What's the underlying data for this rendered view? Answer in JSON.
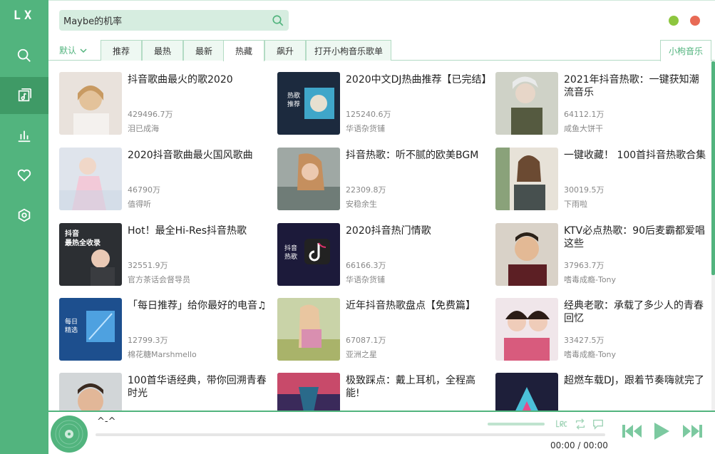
{
  "app": {
    "logo": "LX"
  },
  "sidebar": {
    "items": [
      {
        "name": "search-icon"
      },
      {
        "name": "songlist-icon"
      },
      {
        "name": "leaderboard-icon"
      },
      {
        "name": "heart-icon"
      },
      {
        "name": "settings-icon"
      }
    ],
    "active_index": 1
  },
  "search": {
    "value": "Maybe的机率"
  },
  "tabs": {
    "sort_label": "默认",
    "items": [
      "推荐",
      "最热",
      "最新",
      "热藏",
      "飙升",
      "打开小枸音乐歌单"
    ],
    "active": "热藏",
    "source": "小枸音乐"
  },
  "playlists": [
    {
      "title": "抖音歌曲最火的歌2020",
      "count": "429496.7万",
      "author": "泪已成海"
    },
    {
      "title": "2020中文DJ热曲推荐【已完结】",
      "count": "125240.6万",
      "author": "华语杂货铺"
    },
    {
      "title": "2021年抖音热歌：一键获知潮流音乐",
      "count": "64112.1万",
      "author": "咸鱼大饼干"
    },
    {
      "title": "2020抖音歌曲最火国风歌曲",
      "count": "46790万",
      "author": "值得听"
    },
    {
      "title": "抖音热歌：听不腻的欧美BGM",
      "count": "22309.8万",
      "author": "安稳余生"
    },
    {
      "title": "一键收藏！ 100首抖音热歌合集",
      "count": "30019.5万",
      "author": "下雨啦"
    },
    {
      "title": "Hot！最全Hi-Res抖音热歌",
      "count": "32551.9万",
      "author": "官方茶话会督导员"
    },
    {
      "title": "2020抖音热门情歌",
      "count": "66166.3万",
      "author": "华语杂货铺"
    },
    {
      "title": "KTV必点热歌：90后麦霸都爱唱这些",
      "count": "37963.7万",
      "author": "嗜毒成瘾-Tony"
    },
    {
      "title": "「每日推荐」给你最好的电音♫",
      "count": "12799.3万",
      "author": "棉花糖Marshmello"
    },
    {
      "title": "近年抖音热歌盘点【免费篇】",
      "count": "67087.1万",
      "author": "亚洲之星"
    },
    {
      "title": "经典老歌：承载了多少人的青春回忆",
      "count": "33427.5万",
      "author": "嗜毒成瘾-Tony"
    },
    {
      "title": "100首华语经典，带你回溯青春时光",
      "count": "",
      "author": ""
    },
    {
      "title": "极致踩点：戴上耳机，全程高能!",
      "count": "",
      "author": ""
    },
    {
      "title": "超燃车载DJ，跟着节奏嗨就完了",
      "count": "",
      "author": ""
    }
  ],
  "cover_text": {
    "c2": [
      "热歌",
      "推荐"
    ],
    "c7": [
      "抖音",
      "最热全收录"
    ],
    "c8": [
      "抖音",
      "热歌"
    ],
    "c10": [
      "每日",
      "精选"
    ]
  },
  "player": {
    "song": "^-^",
    "time": "00:00 / 00:00",
    "accent": "#52b47e"
  }
}
